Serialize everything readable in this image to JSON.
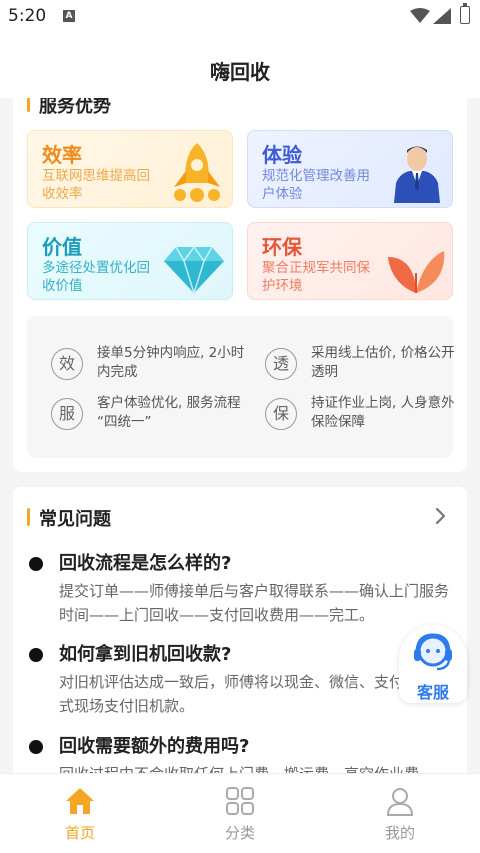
{
  "status_bar": {
    "time": "5:20",
    "notification_icon": "A"
  },
  "header": {
    "title": "嗨回收"
  },
  "advantages": {
    "heading": "服务优势",
    "tiles": [
      {
        "title": "效率",
        "subtitle": "互联网思维提高回收效率",
        "icon": "rocket-icon"
      },
      {
        "title": "体验",
        "subtitle": "规范化管理改善用户体验",
        "icon": "worker-icon"
      },
      {
        "title": "价值",
        "subtitle": "多途径处置优化回收价值",
        "icon": "diamond-icon"
      },
      {
        "title": "环保",
        "subtitle": "聚合正规军共同保护环境",
        "icon": "leaf-icon"
      }
    ],
    "features": [
      {
        "badge": "效",
        "text": "接单5分钟内响应, 2小时内完成"
      },
      {
        "badge": "透",
        "text": "采用线上估价, 价格公开透明"
      },
      {
        "badge": "服",
        "text": "客户体验优化, 服务流程 “四统一”"
      },
      {
        "badge": "保",
        "text": "持证作业上岗, 人身意外保险保障"
      }
    ]
  },
  "faq": {
    "heading": "常见问题",
    "items": [
      {
        "question": "回收流程是怎么样的?",
        "answer": "提交订单——师傅接单后与客户取得联系——确认上门服务时间——上门回收——支付回收费用——完工。"
      },
      {
        "question": "如何拿到旧机回收款?",
        "answer": "对旧机评估达成一致后，师傅将以现金、微信、支付宝等方式现场支付旧机款。"
      },
      {
        "question": "回收需要额外的费用吗?",
        "answer": "回收过程中不会收取任何上门费、搬运费、高空作业费。"
      }
    ]
  },
  "customer_service": {
    "label": "客服"
  },
  "tabbar": {
    "tabs": [
      {
        "label": "首页",
        "icon": "home-icon",
        "active": true
      },
      {
        "label": "分类",
        "icon": "grid-icon",
        "active": false
      },
      {
        "label": "我的",
        "icon": "user-icon",
        "active": false
      }
    ]
  },
  "colors": {
    "accent": "#f5a623",
    "service_blue": "#2f7bea"
  }
}
